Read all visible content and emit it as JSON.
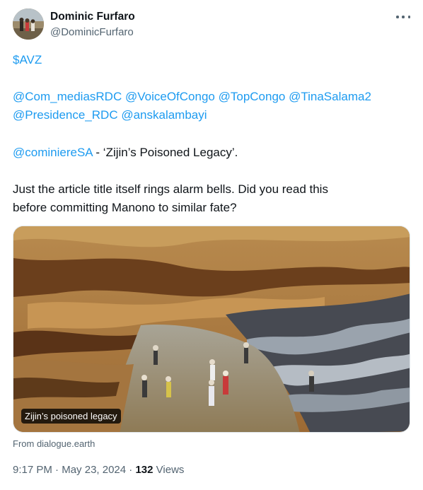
{
  "author": {
    "name": "Dominic Furfaro",
    "handle": "@DominicFurfaro",
    "avatar_icon": "avatar-photo"
  },
  "more_icon": "more-dots-icon",
  "tweet": {
    "cashtag": "$AVZ",
    "mentions_line1": [
      "@Com_mediasRDC",
      "@VoiceOfCongo",
      "@TopCongo",
      "@TinaSalama2"
    ],
    "mentions_line2": [
      "@Presidence_RDC",
      "@anskalambayi"
    ],
    "quote_mention": "@cominiereSA",
    "quote_text": " - ‘Zijin’s Poisoned Legacy’.",
    "body_line1": "Just the article title itself rings alarm bells. Did you read this",
    "body_line2": "before committing Manono to similar fate?"
  },
  "card": {
    "caption": "Zijin’s poisoned legacy",
    "source": "From dialogue.earth"
  },
  "meta": {
    "time": "9:17 PM",
    "separator": " · ",
    "date": "May 23, 2024",
    "views_count": "132",
    "views_label": " Views"
  },
  "colors": {
    "link": "#1d9bf0",
    "secondary_text": "#536471",
    "primary_text": "#0f1419"
  }
}
